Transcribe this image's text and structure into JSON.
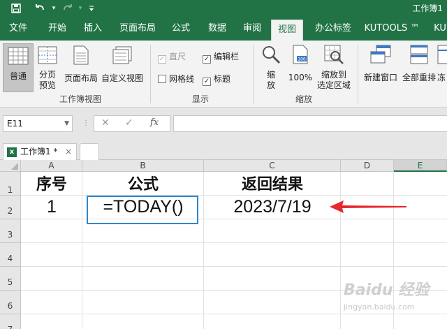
{
  "title_bar": {
    "title": "工作簿1"
  },
  "ribbon_tabs": [
    "文件",
    "开始",
    "插入",
    "页面布局",
    "公式",
    "数据",
    "审阅",
    "视图",
    "办公标签",
    "KUTOOLS ™",
    "KU"
  ],
  "active_tab": "视图",
  "groups": {
    "workbook_views": {
      "label": "工作簿视图",
      "normal": "普通",
      "page_break_line1": "分页",
      "page_break_line2": "预览",
      "page_layout": "页面布局",
      "custom_views": "自定义视图"
    },
    "show": {
      "label": "显示",
      "ruler": "直尺",
      "formula_bar": "编辑栏",
      "gridlines": "网格线",
      "headings": "标题"
    },
    "zoom": {
      "label": "缩放",
      "zoom_line1": "缩",
      "zoom_line2": "放",
      "hundred": "100%",
      "zoom_sel_line1": "缩放到",
      "zoom_sel_line2": "选定区域"
    },
    "window": {
      "new_window": "新建窗口",
      "arrange_all": "全部重排",
      "freeze": "冻"
    }
  },
  "formula_bar": {
    "name_box": "E11",
    "fx_label": "fx",
    "formula": ""
  },
  "workbook_tab": {
    "label": "工作簿1 *",
    "close": "×"
  },
  "grid": {
    "columns": [
      "A",
      "B",
      "C",
      "D",
      "E"
    ],
    "rows": [
      "1",
      "2",
      "3",
      "4",
      "5",
      "6",
      "7"
    ],
    "cells": {
      "A1": "序号",
      "B1": "公式",
      "C1": "返回结果",
      "A2": "1",
      "B2": "=TODAY()",
      "C2": "2023/7/19"
    }
  },
  "watermark": {
    "brand": "Baidu 经验",
    "url": "jingyan.baidu.com"
  },
  "colors": {
    "excel_green": "#217346",
    "highlight_blue": "#2f86c9",
    "arrow_red": "#e8262b"
  }
}
